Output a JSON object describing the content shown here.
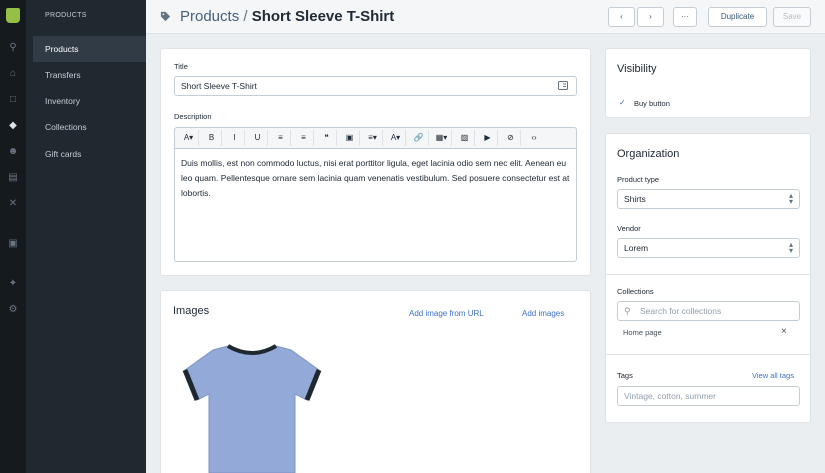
{
  "colors": {
    "rail_bg": "#151a1f",
    "subnav_bg": "#212930",
    "brand_green": "#96bf48",
    "link": "#3f71c9"
  },
  "rail_icons": [
    "search-icon",
    "home-icon",
    "orders-icon",
    "products-icon",
    "customers-icon",
    "reports-icon",
    "discounts-icon",
    "apps-icon",
    "channels-icon",
    "settings-icon"
  ],
  "subnav": {
    "section_title": "PRODUCTS",
    "items": [
      {
        "label": "Products",
        "active": true
      },
      {
        "label": "Transfers"
      },
      {
        "label": "Inventory"
      },
      {
        "label": "Collections"
      },
      {
        "label": "Gift cards"
      }
    ]
  },
  "header": {
    "breadcrumb_parent": "Products",
    "separator": "/",
    "title": "Short Sleeve T-Shirt",
    "prev_label": "‹",
    "next_label": "›",
    "more_label": "···",
    "duplicate_label": "Duplicate",
    "save_label": "Save"
  },
  "main": {
    "title_label": "Title",
    "title_value": "Short Sleeve T-Shirt",
    "description_label": "Description",
    "toolbar": [
      "A▾",
      "B",
      "I",
      "U",
      "≡",
      "≡",
      "❝",
      "▣",
      "≡▾",
      "A▾",
      "🔗",
      "▦▾",
      "▨",
      "▶",
      "⊘",
      "‹›"
    ],
    "description_text": "Duis mollis, est non commodo luctus, nisi erat porttitor ligula, eget lacinia odio sem nec elit. Aenean eu leo quam. Pellentesque ornare sem lacinia quam venenatis vestibulum. Sed posuere consectetur est at lobortis.",
    "images_title": "Images",
    "add_image_url_label": "Add image from URL",
    "add_images_label": "Add images"
  },
  "visibility": {
    "title": "Visibility",
    "check_mark": "✓",
    "buy_button_label": "Buy button",
    "buy_button_checked": true
  },
  "organization": {
    "title": "Organization",
    "product_type_label": "Product type",
    "product_type_value": "Shirts",
    "vendor_label": "Vendor",
    "vendor_value": "Lorem",
    "collections_label": "Collections",
    "collections_placeholder": "Search for collections",
    "collection_item": "Home page",
    "remove_label": "×",
    "tags_label": "Tags",
    "view_all_tags_label": "View all tags",
    "tags_placeholder": "Vintage, cotton, summer"
  }
}
